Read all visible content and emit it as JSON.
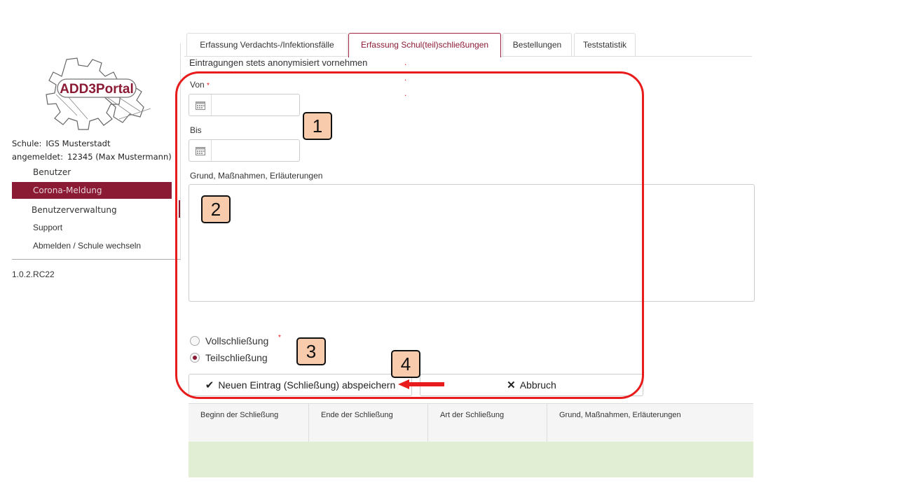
{
  "logo": {
    "text": "ADD3Portal"
  },
  "sidebar": {
    "school_label": "Schule:",
    "school_value": "IGS Musterstadt",
    "user_label": "angemeldet:",
    "user_value": "12345  (Max Mustermann)",
    "items": [
      {
        "label": "Benutzer"
      },
      {
        "label": "Corona-Meldung"
      },
      {
        "label": "Benutzerverwaltung"
      },
      {
        "label": "Support"
      },
      {
        "label": "Abmelden / Schule wechseln"
      }
    ],
    "version": "1.0.2.RC22"
  },
  "tabs": [
    {
      "label": "Erfassung Verdachts-/Infektionsfälle"
    },
    {
      "label": "Erfassung Schul(teil)schließungen"
    },
    {
      "label": "Bestellungen"
    },
    {
      "label": "Teststatistik"
    }
  ],
  "form": {
    "hint": "Eintragungen stets anonymisiert vornehmen",
    "from_label": "Von",
    "to_label": "Bis",
    "reason_label": "Grund, Maßnahmen, Erläuterungen",
    "required_mark": "*",
    "radio_full": "Vollschließung",
    "radio_partial": "Teilschließung",
    "save_button": "Neuen Eintrag (Schließung) abspeichern",
    "cancel_button": "Abbruch"
  },
  "table": {
    "columns": [
      "Beginn der Schließung",
      "Ende der Schließung",
      "Art der Schließung",
      "Grund, Maßnahmen, Erläuterungen"
    ]
  },
  "annotations": {
    "callouts": [
      "1",
      "2",
      "3",
      "4"
    ]
  },
  "colors": {
    "accent": "#8b1a35",
    "annotation": "#e81c1c",
    "callout_fill": "#f8cbad",
    "table_body": "#e2eed4"
  }
}
